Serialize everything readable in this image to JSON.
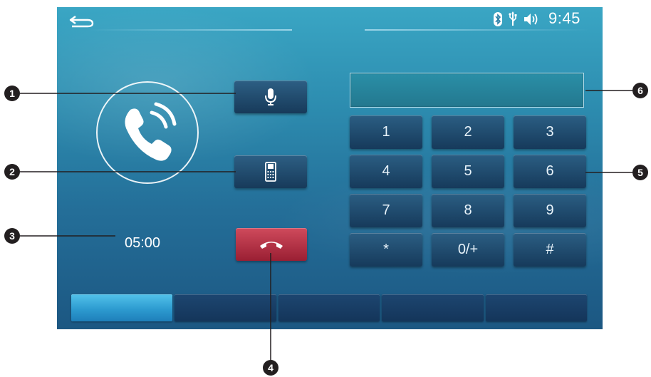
{
  "status_bar": {
    "time": "9:45",
    "icons": [
      "back-icon",
      "bluetooth-icon",
      "usb-icon",
      "speaker-icon"
    ]
  },
  "call": {
    "timer": "05:00",
    "dialed_number": ""
  },
  "keypad": {
    "keys": [
      "1",
      "2",
      "3",
      "4",
      "5",
      "6",
      "7",
      "8",
      "9",
      "*",
      "0/+",
      "#"
    ]
  },
  "controls": {
    "mic_icon": "microphone-icon",
    "handset_icon": "mobile-phone-icon",
    "end_call_icon": "hang-up-icon"
  },
  "tabs": {
    "count": 5,
    "active_index": 0
  },
  "callouts": [
    "1",
    "2",
    "3",
    "4",
    "5",
    "6"
  ],
  "colors": {
    "end_call": "#b8304a",
    "active_tab": "#3fb2e0",
    "button": "#1e4a70"
  }
}
